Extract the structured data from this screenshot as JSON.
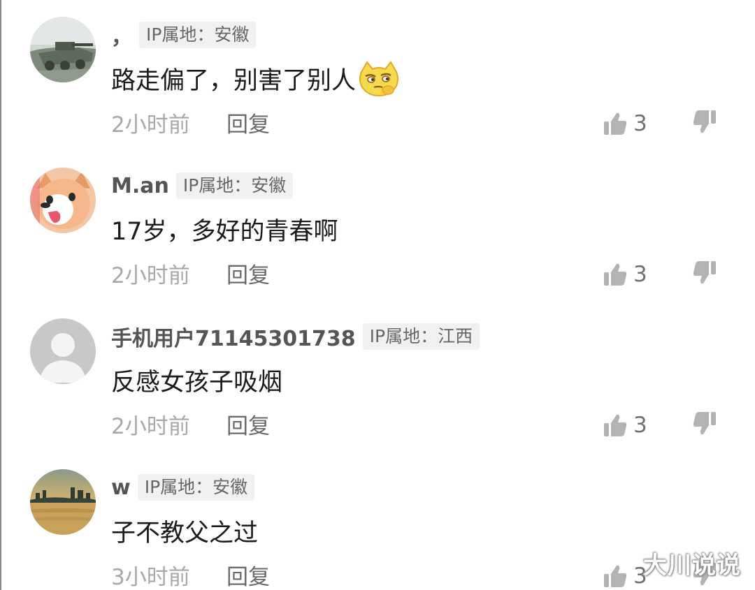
{
  "comments": [
    {
      "username": "，",
      "ip_location": "IP属地：安徽",
      "text": "路走偏了，别害了别人",
      "emoji": "thinking-cat-emoji",
      "time": "2小时前",
      "reply_label": "回复",
      "like_count": "3",
      "avatar": "military-vehicle-photo"
    },
    {
      "username": "M.an",
      "ip_location": "IP属地：安徽",
      "text": "17岁，多好的青春啊",
      "time": "2小时前",
      "reply_label": "回复",
      "like_count": "3",
      "avatar": "cartoon-dog-photo"
    },
    {
      "username": "手机用户71145301738",
      "ip_location": "IP属地：江西",
      "text": "反感女孩子吸烟",
      "time": "2小时前",
      "reply_label": "回复",
      "like_count": "3",
      "avatar": "default-user-avatar"
    },
    {
      "username": "w",
      "ip_location": "IP属地：安徽",
      "text": "子不教父之过",
      "time": "3小时前",
      "reply_label": "回复",
      "like_count": "3",
      "avatar": "sunset-skyline-photo"
    }
  ],
  "watermark": "大川说说",
  "colors": {
    "username": "#555555",
    "badge_bg": "#f1f1f1",
    "badge_text": "#666666",
    "comment_text": "#1b1b1b",
    "time": "#a8a8a8",
    "reply": "#6a6a6a",
    "icon": "#b3b3b3"
  }
}
